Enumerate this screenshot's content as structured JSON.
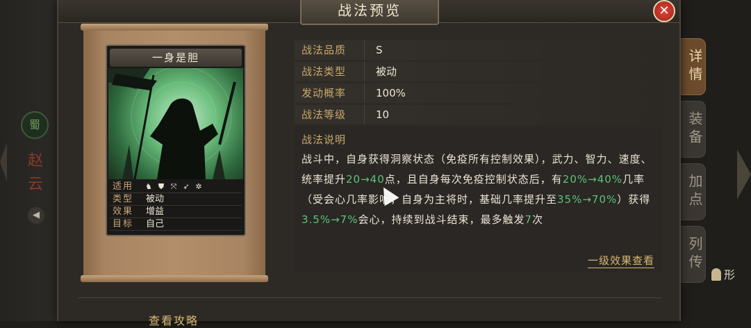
{
  "background": {
    "faction_icon": "蜀",
    "hero_name": "赵云",
    "voice_icon": "speaker-icon",
    "side_tabs": [
      "详情",
      "装备",
      "加点",
      "列传"
    ],
    "player_tag": "形"
  },
  "dialog": {
    "title": "战法预览",
    "close_label": "✕",
    "card": {
      "name": "一身是胆",
      "rows": [
        {
          "key": "适用",
          "troops": [
            "cavalry-icon",
            "shield-icon",
            "archer-icon",
            "spear-icon",
            "siege-icon"
          ]
        },
        {
          "key": "类型",
          "value": "被动"
        },
        {
          "key": "效果",
          "value": "增益"
        },
        {
          "key": "目标",
          "value": "自己"
        }
      ]
    },
    "stats": [
      {
        "label": "战法品质",
        "value": "S"
      },
      {
        "label": "战法类型",
        "value": "被动"
      },
      {
        "label": "发动概率",
        "value": "100%"
      },
      {
        "label": "战法等级",
        "value": "10"
      }
    ],
    "description": {
      "label": "战法说明",
      "seg1": "战斗中，自身获得洞察状态（免疫所有控制效果），武力、智力、速度、统率提升",
      "hl1": "20→40",
      "seg2": "点，且自身每次免疫控制状态后，有",
      "hl2": "20%→40%",
      "seg3": "几率（受会心几率影响，自身为主将时，基础几率提升至",
      "hl3": "35%→70%",
      "seg4": "）获得",
      "hl4": "3.5%→7%",
      "seg5": "会心，持续到战斗结束，最多触发",
      "hl5": "7",
      "seg6": "次"
    },
    "level_link": "一级效果查看",
    "guide_link": "查看攻略"
  }
}
